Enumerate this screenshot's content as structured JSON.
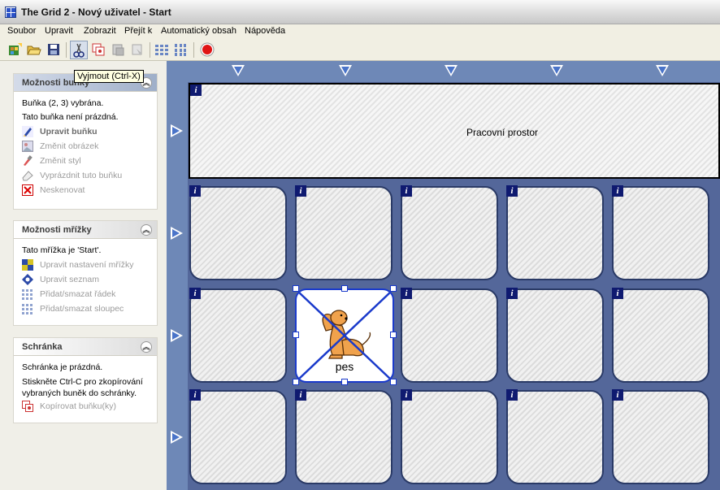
{
  "window": {
    "title": "The Grid 2 - Nový uživatel - Start"
  },
  "menu": [
    "Soubor",
    "Upravit",
    "Zobrazit",
    "Přejít k",
    "Automatický obsah",
    "Nápověda"
  ],
  "toolbar": {
    "tooltip": "Vyjmout (Ctrl-X)",
    "icons": [
      "new-grid-icon",
      "open-folder-icon",
      "save-icon",
      "cut-icon",
      "copy-icon",
      "paste-icon",
      "paste-style-icon",
      "grid-rows-icon",
      "grid-cols-icon",
      "record-icon"
    ]
  },
  "panels": {
    "cell": {
      "title": "Možnosti buňky",
      "status1": "Buňka (2, 3) vybrána.",
      "status2": "Tato buňka není prázdná.",
      "links": [
        "Upravit buňku",
        "Změnit obrázek",
        "Změnit styl",
        "Vyprázdnit tuto buňku",
        "Neskenovat"
      ]
    },
    "grid": {
      "title": "Možnosti mřížky",
      "status": "Tato mřížka je 'Start'.",
      "links": [
        "Upravit nastavení mřížky",
        "Upravit seznam",
        "Přidat/smazat řádek",
        "Přidat/smazat sloupec"
      ]
    },
    "clipboard": {
      "title": "Schránka",
      "status": "Schránka je prázdná.",
      "hint1": "Stiskněte Ctrl-C pro zkopírování",
      "hint2": "vybraných buněk do schránky.",
      "link": "Kopírovat buňku(ky)"
    }
  },
  "grid": {
    "workspace_label": "Pracovní prostor",
    "info_glyph": "i",
    "selected_cell": {
      "label": "pes",
      "row": 2,
      "col": 3
    }
  },
  "colors": {
    "grid_background": "#54679a",
    "cell_border": "#2a3a66",
    "selection": "#1a3acb",
    "info_badge": "#0f1a70"
  }
}
